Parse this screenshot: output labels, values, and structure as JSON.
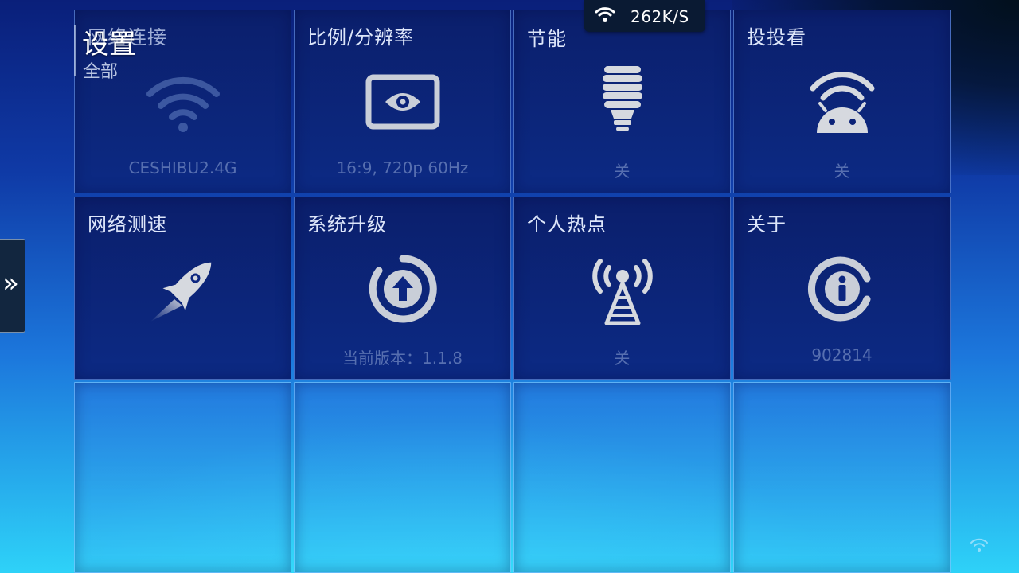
{
  "status_bar": {
    "speed": "262K/S",
    "wifi_icon": "wifi-icon"
  },
  "header": {
    "title": "设置",
    "subtitle": "全部"
  },
  "side_tab": {
    "glyph": "»",
    "icon": "double-chevron-right-icon"
  },
  "tiles": [
    {
      "title": "网络连接",
      "value": "CESHIBU2.4G",
      "icon": "wifi-icon"
    },
    {
      "title": "比例/分辨率",
      "value": "16:9, 720p 60Hz",
      "icon": "eye-screen-icon"
    },
    {
      "title": "节能",
      "value": "关",
      "icon": "lightbulb-icon"
    },
    {
      "title": "投投看",
      "value": "关",
      "icon": "android-cast-icon"
    },
    {
      "title": "网络测速",
      "value": "",
      "icon": "rocket-icon"
    },
    {
      "title": "系统升级",
      "value": "当前版本：1.1.8",
      "icon": "upgrade-arrow-icon"
    },
    {
      "title": "个人热点",
      "value": "关",
      "icon": "hotspot-tower-icon"
    },
    {
      "title": "关于",
      "value": "902814",
      "icon": "info-icon"
    }
  ],
  "colors": {
    "tile_bg": "#0b1f6c",
    "bg_top": "#0a1f7a",
    "bg_bottom": "#2ed2f8",
    "pill_bg": "#0a1a33"
  }
}
